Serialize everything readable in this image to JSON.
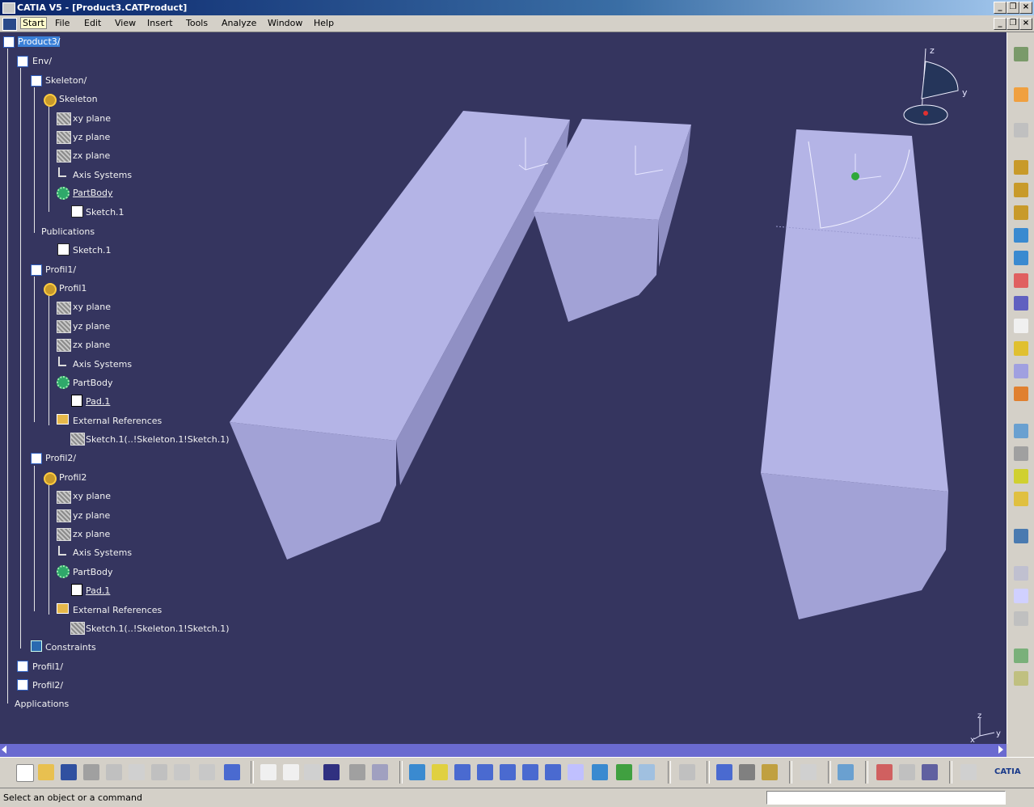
{
  "window": {
    "title": "CATIA V5 - [Product3.CATProduct]"
  },
  "menu": [
    "Start",
    "File",
    "Edit",
    "View",
    "Insert",
    "Tools",
    "Analyze",
    "Window",
    "Help"
  ],
  "tree": [
    {
      "label": "Product3/",
      "icon": "product-icon",
      "selected": true
    },
    {
      "label": "Env/",
      "icon": "product-icon"
    },
    {
      "label": "Skeleton/",
      "icon": "product-icon"
    },
    {
      "label": "Skeleton",
      "icon": "gear-icon"
    },
    {
      "label": "xy plane",
      "icon": "plane-icon"
    },
    {
      "label": "yz plane",
      "icon": "plane-icon"
    },
    {
      "label": "zx plane",
      "icon": "plane-icon"
    },
    {
      "label": "Axis Systems",
      "icon": "axis-icon"
    },
    {
      "label": "PartBody",
      "icon": "body-icon",
      "underline": true
    },
    {
      "label": "Sketch.1",
      "icon": "sketch-icon"
    },
    {
      "label": "Publications",
      "icon": "none"
    },
    {
      "label": "Sketch.1",
      "icon": "sketch-icon"
    },
    {
      "label": "Profil1/",
      "icon": "product-icon"
    },
    {
      "label": "Profil1",
      "icon": "gear-icon"
    },
    {
      "label": "xy plane",
      "icon": "plane-icon"
    },
    {
      "label": "yz plane",
      "icon": "plane-icon"
    },
    {
      "label": "zx plane",
      "icon": "plane-icon"
    },
    {
      "label": "Axis Systems",
      "icon": "axis-icon"
    },
    {
      "label": "PartBody",
      "icon": "body-icon"
    },
    {
      "label": "Pad.1",
      "icon": "pad-icon",
      "underline": true
    },
    {
      "label": "External References",
      "icon": "ref-icon"
    },
    {
      "label": "Sketch.1(..!Skeleton.1!Sketch.1)",
      "icon": "plane-icon"
    },
    {
      "label": "Profil2/",
      "icon": "product-icon"
    },
    {
      "label": "Profil2",
      "icon": "gear-icon"
    },
    {
      "label": "xy plane",
      "icon": "plane-icon"
    },
    {
      "label": "yz plane",
      "icon": "plane-icon"
    },
    {
      "label": "zx plane",
      "icon": "plane-icon"
    },
    {
      "label": "Axis Systems",
      "icon": "axis-icon"
    },
    {
      "label": "PartBody",
      "icon": "body-icon"
    },
    {
      "label": "Pad.1",
      "icon": "pad-icon",
      "underline": true
    },
    {
      "label": "External References",
      "icon": "ref-icon"
    },
    {
      "label": "Sketch.1(..!Skeleton.1!Sketch.1)",
      "icon": "plane-icon"
    },
    {
      "label": "Constraints",
      "icon": "constr-icon"
    },
    {
      "label": "Profil1/",
      "icon": "product-icon"
    },
    {
      "label": "Profil2/",
      "icon": "product-icon"
    },
    {
      "label": "Applications",
      "icon": "none"
    }
  ],
  "compass": {
    "z": "z",
    "y": "y"
  },
  "axes_labels": {
    "x": "x",
    "y": "y",
    "z": "z"
  },
  "status": {
    "message": "Select an object or a command"
  },
  "colors": {
    "background": "#35355f",
    "solid": "#b4b4e6",
    "solid_dark": "#9b9bd0"
  }
}
